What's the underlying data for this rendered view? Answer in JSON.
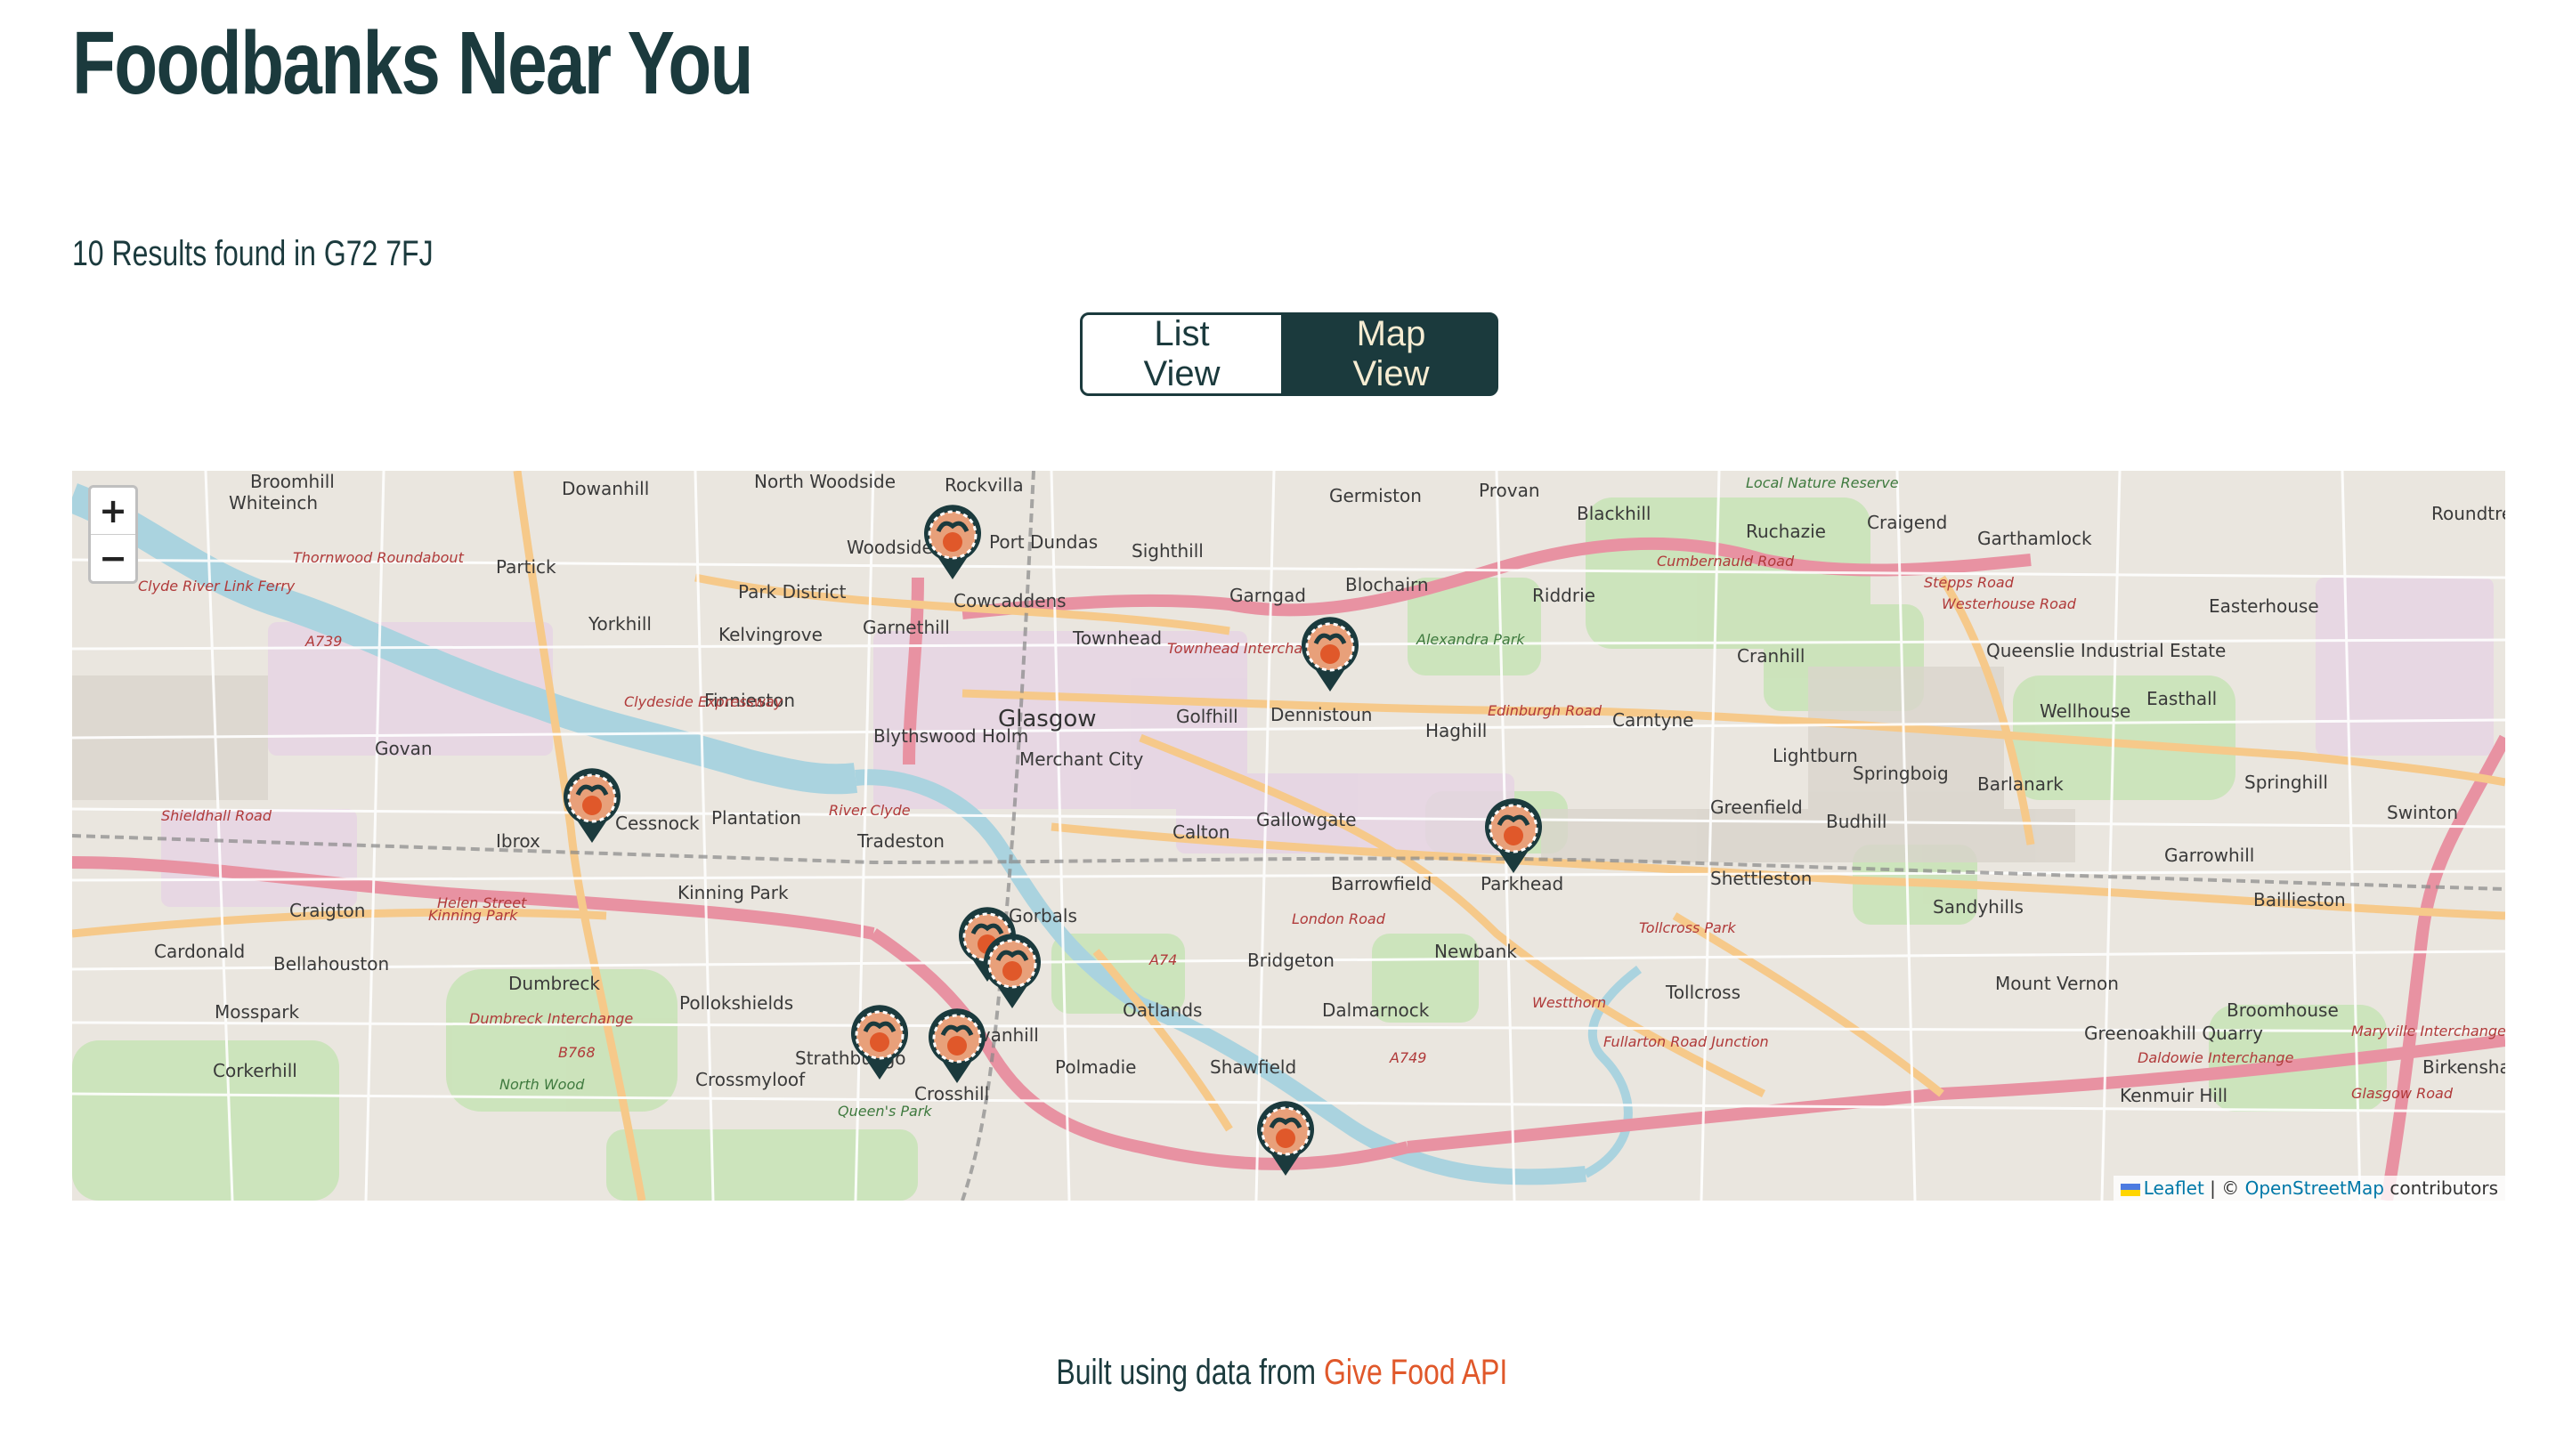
{
  "page": {
    "title": "Foodbanks Near You"
  },
  "results": {
    "summary": "10 Results found in G72 7FJ"
  },
  "view_toggle": {
    "list_label": "List View",
    "map_label": "Map View",
    "active": "Map View"
  },
  "map": {
    "zoom_in": "+",
    "zoom_out": "−",
    "marker_count": 9,
    "place_labels": [
      "Broomhill",
      "Dowanhill",
      "North Woodside",
      "Rockvilla",
      "Germiston",
      "Provan",
      "Blackhill",
      "Local Nature Reserve",
      "Ruchazie",
      "Craigend",
      "Garthamlock",
      "Roundtree Hill",
      "Whiteinch",
      "Partick",
      "Woodside",
      "Port Dundas",
      "Sighthill",
      "Garngad",
      "Blochairn",
      "Riddrie",
      "Easterhouse",
      "Yorkhill",
      "Park District",
      "Cowcaddens",
      "Kelvingrove",
      "Garnethill",
      "Townhead",
      "Alexandra Park",
      "Cranhill",
      "Queenslie Industrial Estate",
      "Finnieston",
      "Glasgow",
      "Golfhill",
      "Dennistoun",
      "Haghill",
      "Carntyne",
      "Wellhouse",
      "Easthall",
      "Govan",
      "Blythswood Holm",
      "Merchant City",
      "Lightburn",
      "Springboig",
      "Barlanark",
      "Springhill",
      "Swinton",
      "Cessnock",
      "Plantation",
      "Gallowgate",
      "Greenfield",
      "Budhill",
      "Garrowhill",
      "Ibrox",
      "Tradeston",
      "Calton",
      "Parkhead",
      "Shettleston",
      "Craigton",
      "Kinning Park",
      "Barrowfield",
      "Sandyhills",
      "Baillieston",
      "Cardonald",
      "Gorbals",
      "Bridgeton",
      "Newbank",
      "Bellahouston",
      "Dumbreck",
      "Mount Vernon",
      "Tollcross",
      "Pollokshields",
      "Oatlands",
      "Dalmarnock",
      "Broomhouse",
      "Mosspark",
      "Govanhill",
      "Strathbungo",
      "Polmadie",
      "Shawfield",
      "Corkerhill",
      "Crossmyloof",
      "Crosshill",
      "Greenoakhill Quarry",
      "Birkenshaw",
      "Kenmuir Hill",
      "North Wood",
      "Queen's Park"
    ],
    "road_labels": [
      "A739",
      "B768",
      "A74",
      "A749",
      "Thornwood Roundabout",
      "Clyde River Link Ferry",
      "Cumbernauld Road",
      "Edinburgh Road",
      "London Road",
      "Westerhouse Road",
      "Stepps Road",
      "Shieldhall Road",
      "Helen Street",
      "Dumbreck Interchange",
      "Fullarton Road Junction",
      "Maryville Interchange",
      "Daldowie Interchange",
      "Glasgow Road",
      "Townhead Interchange",
      "Kinning Park",
      "River Clyde",
      "Clydeside Expressway",
      "Tollcross Park",
      "Westthorn"
    ],
    "attribution": {
      "leaflet": "Leaflet",
      "sep": " | © ",
      "osm": "OpenStreetMap",
      "suffix": " contributors"
    }
  },
  "footer": {
    "text": "Built using data from ",
    "link": "Give Food API"
  },
  "colors": {
    "primary": "#1b3a3d",
    "accent": "#e0582a",
    "cream": "#f6ecd2"
  }
}
